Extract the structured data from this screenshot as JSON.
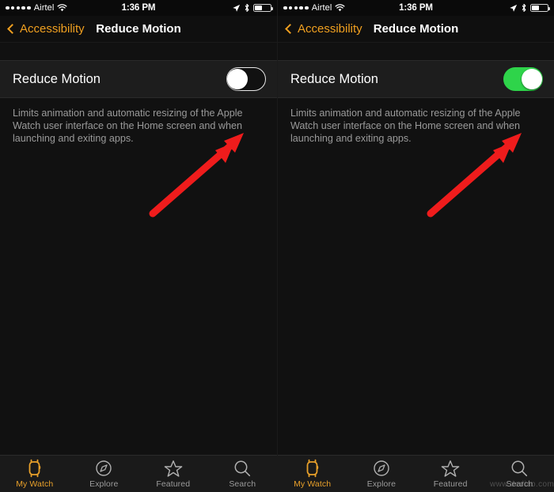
{
  "panels": [
    {
      "id": "left",
      "status_bar": {
        "signal_dots": 5,
        "carrier": "Airtel",
        "wifi_icon": "wifi-icon",
        "time": "1:36 PM",
        "location_icon": "location-arrow-icon",
        "bluetooth_icon": "bluetooth-icon",
        "battery_percent": 45
      },
      "nav": {
        "back_label": "Accessibility",
        "title": "Reduce Motion"
      },
      "setting": {
        "label": "Reduce Motion",
        "toggle_state": "off",
        "toggle_state_label": "Off",
        "footnote": "Limits animation and automatic resizing of the Apple Watch user interface on the Home screen and when launching and exiting apps."
      },
      "annotation": {
        "type": "red-arrow",
        "points_to": "reduce-motion-toggle",
        "color": "#ef1c1c"
      },
      "tabs": [
        {
          "label": "My Watch",
          "icon": "apple-watch-icon",
          "active": true
        },
        {
          "label": "Explore",
          "icon": "compass-icon",
          "active": false
        },
        {
          "label": "Featured",
          "icon": "star-icon",
          "active": false
        },
        {
          "label": "Search",
          "icon": "search-icon",
          "active": false
        }
      ],
      "watermark": ""
    },
    {
      "id": "right",
      "status_bar": {
        "signal_dots": 5,
        "carrier": "Airtel",
        "wifi_icon": "wifi-icon",
        "time": "1:36 PM",
        "location_icon": "location-arrow-icon",
        "bluetooth_icon": "bluetooth-icon",
        "battery_percent": 45
      },
      "nav": {
        "back_label": "Accessibility",
        "title": "Reduce Motion"
      },
      "setting": {
        "label": "Reduce Motion",
        "toggle_state": "on",
        "toggle_state_label": "On",
        "footnote": "Limits animation and automatic resizing of the Apple Watch user interface on the Home screen and when launching and exiting apps."
      },
      "annotation": {
        "type": "red-arrow",
        "points_to": "reduce-motion-toggle",
        "color": "#ef1c1c"
      },
      "tabs": [
        {
          "label": "My Watch",
          "icon": "apple-watch-icon",
          "active": true
        },
        {
          "label": "Explore",
          "icon": "compass-icon",
          "active": false
        },
        {
          "label": "Featured",
          "icon": "star-icon",
          "active": false
        },
        {
          "label": "Search",
          "icon": "search-icon",
          "active": false
        }
      ],
      "watermark": "www.dediao.com"
    }
  ],
  "colors": {
    "accent_orange": "#f0a020",
    "toggle_on_green": "#2ed44a",
    "arrow_red": "#ef1c1c",
    "background": "#111111",
    "cell_background": "#1d1d1d",
    "footnote_text": "#9a9a9a"
  }
}
